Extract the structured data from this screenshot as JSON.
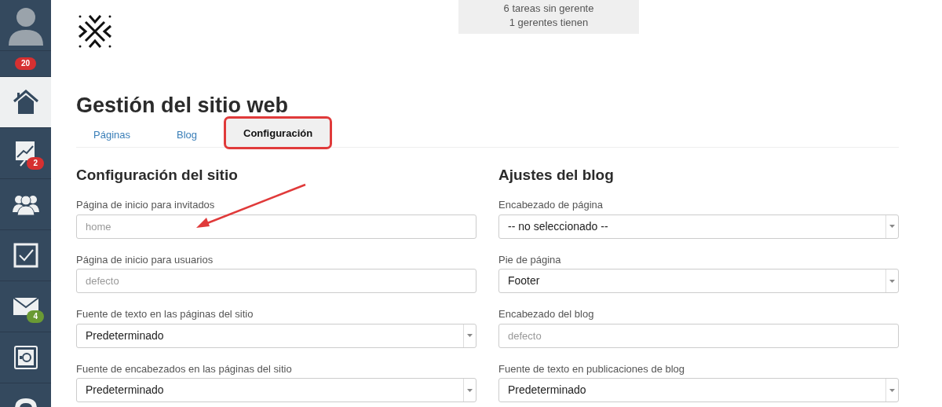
{
  "sidebar": {
    "items": [
      {
        "kind": "avatar",
        "selected": false
      },
      {
        "kind": "counter",
        "badge": "20",
        "color": "#d63031",
        "selected": false
      },
      {
        "kind": "home",
        "selected": true
      },
      {
        "kind": "chart",
        "badge": "2",
        "color": "#d63031",
        "selected": false
      },
      {
        "kind": "users",
        "selected": false
      },
      {
        "kind": "tasks",
        "selected": false
      },
      {
        "kind": "mail",
        "badge": "4",
        "color": "#6a9a34",
        "selected": false
      },
      {
        "kind": "safe",
        "selected": false
      },
      {
        "kind": "partial",
        "selected": false
      }
    ]
  },
  "notice": [
    "6 tareas sin gerente",
    "1 gerentes tienen"
  ],
  "title": "Gestión del sitio web",
  "tabs": [
    {
      "label": "Páginas",
      "selected": false,
      "highlighted": false
    },
    {
      "label": "Blog",
      "selected": false,
      "highlighted": false
    },
    {
      "label": "Configuración",
      "selected": true,
      "highlighted": true
    }
  ],
  "sections": [
    {
      "heading": "Configuración del sitio",
      "fields": [
        {
          "label": "Página de inicio para invitados",
          "kind": "input",
          "placeholder": "home",
          "pointed": true
        },
        {
          "label": "Página de inicio para usuarios",
          "kind": "input",
          "placeholder": "defecto",
          "pointed": false
        },
        {
          "label": "Fuente de texto en las páginas del sitio",
          "kind": "select",
          "value": "Predeterminado",
          "pointed": false
        },
        {
          "label": "Fuente de encabezados en las páginas del sitio",
          "kind": "select",
          "value": "Predeterminado",
          "pointed": false
        }
      ]
    },
    {
      "heading": "Ajustes del blog",
      "fields": [
        {
          "label": "Encabezado de página",
          "kind": "select",
          "value": "-- no seleccionado --",
          "pointed": false
        },
        {
          "label": "Pie de página",
          "kind": "select",
          "value": "Footer",
          "pointed": false
        },
        {
          "label": "Encabezado del blog",
          "kind": "input",
          "placeholder": "defecto",
          "pointed": false
        },
        {
          "label": "Fuente de texto en publicaciones de blog",
          "kind": "select",
          "value": "Predeterminado",
          "pointed": false
        }
      ]
    }
  ]
}
